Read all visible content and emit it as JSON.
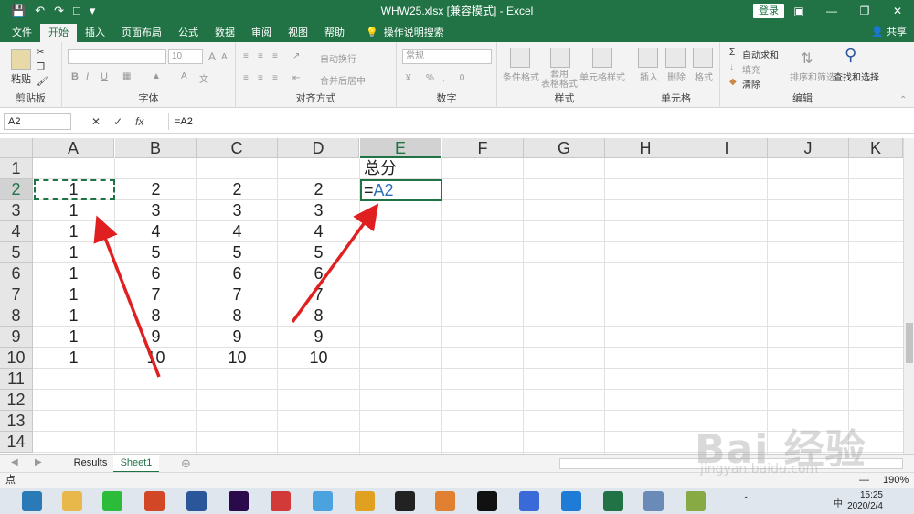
{
  "window": {
    "title": "WHW25.xlsx  [兼容模式]  -  Excel",
    "login_label": "登录",
    "share_label": "共享"
  },
  "ribbon_tabs": [
    "文件",
    "开始",
    "插入",
    "页面布局",
    "公式",
    "数据",
    "审阅",
    "视图",
    "帮助"
  ],
  "tell_me": "操作说明搜索",
  "ribbon": {
    "clipboard": {
      "paste": "粘贴",
      "label": "剪贴板"
    },
    "font": {
      "size": "10",
      "bold": "B",
      "italic": "I",
      "underline": "U",
      "label": "字体",
      "big_a": "A",
      "small_a": "A"
    },
    "alignment": {
      "wrap": "自动换行",
      "merge": "合并后居中",
      "label": "对齐方式"
    },
    "number": {
      "format": "常规",
      "label": "数字"
    },
    "styles": {
      "conditional": "条件格式",
      "table": "套用\n表格格式",
      "cell": "单元格样式",
      "label": "样式"
    },
    "cells": {
      "insert": "插入",
      "delete": "删除",
      "format": "格式",
      "label": "单元格"
    },
    "editing": {
      "autosum": "自动求和",
      "fill": "填充",
      "clear": "清除",
      "sort": "排序和筛选",
      "find": "查找和选择",
      "label": "编辑"
    }
  },
  "formula_bar": {
    "name_box": "A2",
    "fx": "fx",
    "formula": "=A2"
  },
  "columns": [
    "A",
    "B",
    "C",
    "D",
    "E",
    "F",
    "G",
    "H",
    "I",
    "J",
    "K"
  ],
  "rows": [
    "1",
    "2",
    "3",
    "4",
    "5",
    "6",
    "7",
    "8",
    "9",
    "10",
    "11",
    "12",
    "13",
    "14"
  ],
  "cells": {
    "e1": "总分",
    "e2_eq": "=",
    "e2_ref": "A2",
    "a": [
      "1",
      "1",
      "1",
      "1",
      "1",
      "1",
      "1",
      "1",
      "1"
    ],
    "b": [
      "2",
      "3",
      "4",
      "5",
      "6",
      "7",
      "8",
      "9",
      "10"
    ],
    "c": [
      "2",
      "3",
      "4",
      "5",
      "6",
      "7",
      "8",
      "9",
      "10"
    ],
    "d": [
      "2",
      "3",
      "4",
      "5",
      "6",
      "7",
      "8",
      "9",
      "10"
    ]
  },
  "sheets": [
    "Results",
    "Sheet1"
  ],
  "active_sheet": "Sheet1",
  "status": {
    "mode": "点",
    "zoom": "190%"
  },
  "taskbar": {
    "time": "15:25",
    "date": "2020/2/4",
    "ime": "中"
  },
  "watermark": {
    "text": "Bai 经验",
    "url": "jingyan.baidu.com"
  },
  "colors": {
    "excel_green": "#217346",
    "arrow_red": "#e02020",
    "ref_blue": "#2f6fb6"
  }
}
